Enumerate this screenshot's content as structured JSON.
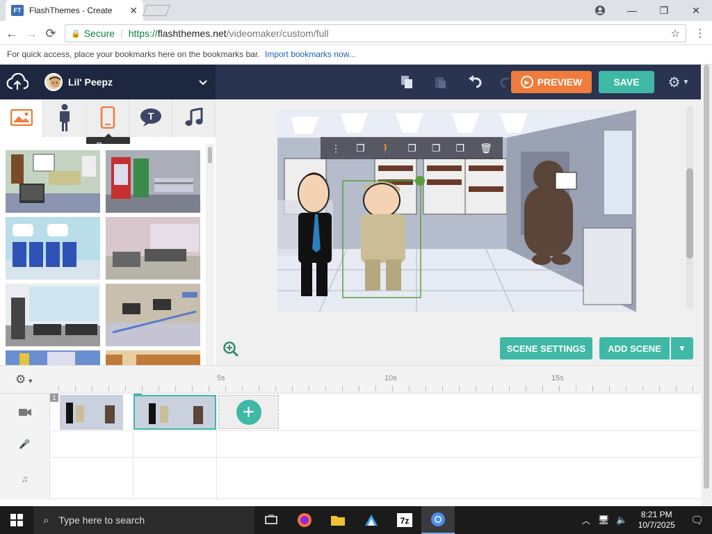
{
  "browser": {
    "tab_title": "FlashThemes - Create",
    "favicon_text": "FT",
    "secure_label": "Secure",
    "url_scheme": "https://",
    "url_host": "flashthemes.net",
    "url_path": "/videomaker/custom/full",
    "bookmarks_prompt": "For quick access, place your bookmarks here on the bookmarks bar.",
    "bookmarks_link": "Import bookmarks now..."
  },
  "app": {
    "theme_name": "Lil' Peepz",
    "preview_label": "PREVIEW",
    "save_label": "SAVE",
    "tooltip_props": "Props",
    "scene_settings_label": "SCENE SETTINGS",
    "add_scene_label": "ADD SCENE",
    "accent_color": "#3fb8a6",
    "preview_color": "#ef7c3b",
    "categories": [
      "backgrounds",
      "characters",
      "props",
      "text",
      "audio"
    ],
    "active_category": "backgrounds"
  },
  "timeline": {
    "ticks": [
      "5s",
      "10s",
      "15s"
    ],
    "scenes": [
      {
        "number": "1"
      },
      {
        "number": "2"
      }
    ],
    "selected_scene": "2",
    "tracks": [
      "video-track",
      "voice-track",
      "music-track"
    ]
  },
  "taskbar": {
    "search_placeholder": "Type here to search",
    "time": "8:21 PM",
    "date": "10/7/2025"
  }
}
